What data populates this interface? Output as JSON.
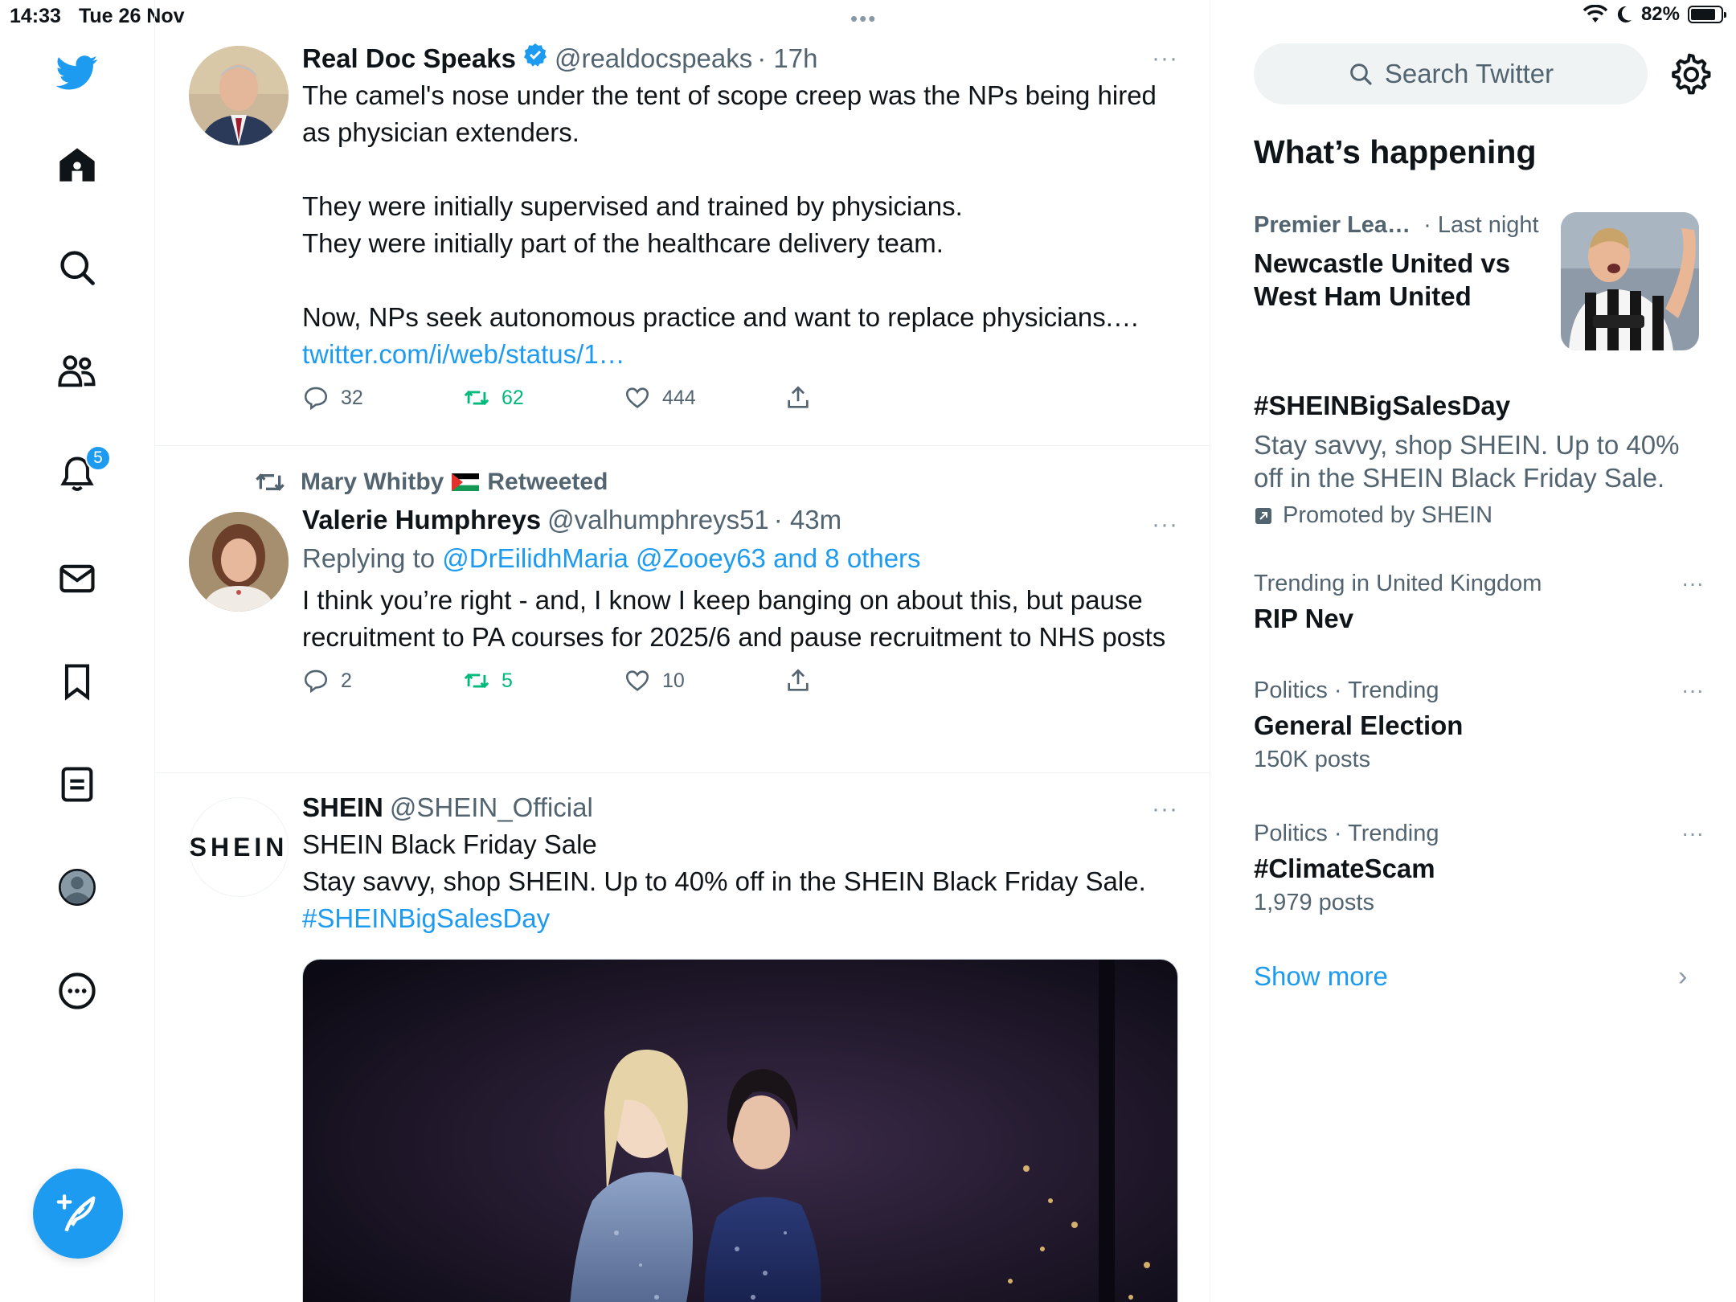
{
  "status_bar": {
    "time": "14:33",
    "date": "Tue 26 Nov",
    "battery": "82%",
    "battery_level": 0.82
  },
  "nav": {
    "notifications_badge": "5"
  },
  "tweets": [
    {
      "name": "Real Doc Speaks",
      "handle": "@realdocspeaks",
      "time": "· 17h",
      "verified": true,
      "more": "···",
      "text": "The camel's nose under the tent of scope creep was the NPs being hired as physician extenders.\n\nThey were initially supervised and trained by physicians.\nThey were initially part of the healthcare delivery team.\n\nNow, NPs seek autonomous practice and want to replace physicians.…",
      "link": "twitter.com/i/web/status/1…",
      "replies": "32",
      "retweets": "62",
      "likes": "444"
    },
    {
      "retweeted_by": "Mary Whitby",
      "retweeted_flag": "🇵🇸",
      "retweeted_label": "Retweeted",
      "name": "Valerie Humphreys",
      "handle": "@valhumphreys51",
      "time": "· 43m",
      "more": "···",
      "replying_prefix": "Replying to ",
      "replying_to": "@DrEilidhMaria @Zooey63 and 8 others",
      "text": "I think you’re right - and, I know I keep banging on about this, but pause recruitment to PA courses for 2025/6 and pause recruitment to NHS posts",
      "replies": "2",
      "retweets": "5",
      "likes": "10"
    },
    {
      "name": "SHEIN",
      "handle": "@SHEIN_Official",
      "avatar_text": "SHEIN",
      "more": "···",
      "line1": "SHEIN Black Friday Sale",
      "line2": "Stay savvy, shop SHEIN.  Up to 40% off in the SHEIN Black Friday Sale.",
      "hashtag": "#SHEINBigSalesDay"
    }
  ],
  "sidebar": {
    "search_placeholder": "Search Twitter",
    "whats_happening": "What’s happening",
    "trends": [
      {
        "meta_category": "Premier Lea…",
        "meta_time": "· Last night",
        "title": "Newcastle United vs West Ham United"
      },
      {
        "title": "#SHEINBigSalesDay",
        "description": "Stay savvy, shop SHEIN. Up to 40% off in the SHEIN Black Friday Sale.",
        "promoted": "Promoted by SHEIN"
      },
      {
        "meta": "Trending in United Kingdom",
        "title": "RIP Nev",
        "more": "···"
      },
      {
        "meta": "Politics · Trending",
        "title": "General Election",
        "count": "150K posts",
        "more": "···"
      },
      {
        "meta": "Politics · Trending",
        "title": "#ClimateScam",
        "count": "1,979 posts",
        "more": "···"
      }
    ],
    "show_more": "Show more"
  },
  "colors": {
    "accent": "#1d9bf0",
    "retweet_green": "#00ba7c",
    "secondary_text": "#536471"
  }
}
